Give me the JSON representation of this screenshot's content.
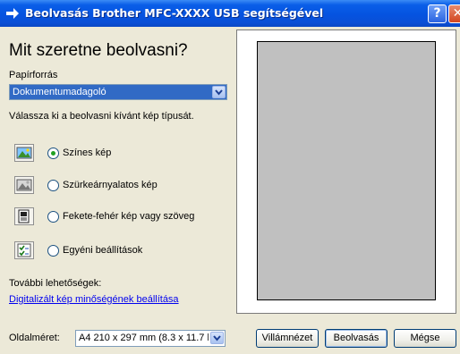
{
  "window": {
    "title": "Beolvasás Brother  MFC-XXXX   USB segítségével",
    "help_glyph": "?",
    "close_glyph": "✕"
  },
  "left": {
    "heading": "Mit szeretne beolvasni?",
    "source_label": "Papírforrás",
    "source_value": "Dokumentumadagoló",
    "type_prompt": "Válassza ki a beolvasni kívánt kép típusát.",
    "options": [
      {
        "label": "Színes kép",
        "icon": "color-photo-icon",
        "selected": true
      },
      {
        "label": "Szürkeárnyalatos kép",
        "icon": "grayscale-photo-icon",
        "selected": false
      },
      {
        "label": "Fekete-fehér kép vagy szöveg",
        "icon": "bw-text-icon",
        "selected": false
      },
      {
        "label": "Egyéni beállítások",
        "icon": "custom-settings-icon",
        "selected": false
      }
    ],
    "more_options_label": "További lehetőségek:",
    "quality_link": "Digitalizált kép minőségének beállítása"
  },
  "bottom": {
    "page_size_label": "Oldalméret:",
    "page_size_value": "A4 210 x 297 mm (8.3 x 11.7 hüv",
    "preview_button": "Villámnézet",
    "scan_button": "Beolvasás",
    "cancel_button": "Mégse"
  }
}
